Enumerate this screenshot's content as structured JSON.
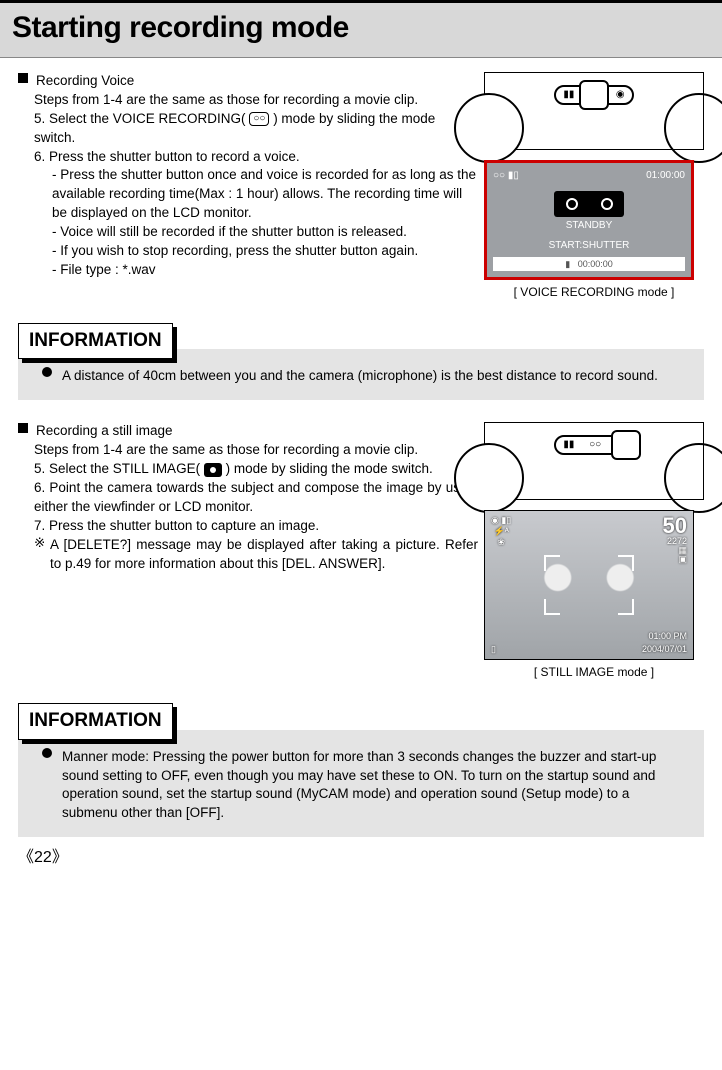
{
  "page": {
    "title": "Starting recording mode",
    "number": "22"
  },
  "voice": {
    "heading": "Recording Voice",
    "intro": "Steps from 1-4 are the same as those for recording a movie clip.",
    "step5_pre": "5. Select the VOICE RECORDING(",
    "step5_post": " ) mode by sliding the mode switch.",
    "step6": "6. Press the shutter button to record a voice.",
    "d1": "- Press the shutter button once and voice is recorded for as long as the available recording time(Max : 1 hour) allows. The recording time will be displayed on the LCD monitor.",
    "d2": "- Voice will still be recorded if the shutter button is released.",
    "d3": "- If you wish to stop recording, press the shutter button again.",
    "d4": "- File type : *.wav",
    "lcd": {
      "time": "01:00:00",
      "standby": "STANDBY",
      "start": "START:SHUTTER",
      "counter": "00:00:00"
    },
    "caption": "[ VOICE RECORDING mode ]"
  },
  "info1": {
    "heading": "INFORMATION",
    "text": "A distance of 40cm between you and the camera (microphone) is the best distance to record sound."
  },
  "still": {
    "heading": "Recording a still image",
    "intro": "Steps from 1-4 are the same as those for recording a movie clip.",
    "step5_pre": "5. Select the STILL IMAGE(",
    "step5_post": " ) mode by sliding the mode switch.",
    "step6": "6. Point the camera towards the subject and compose the image by using either the viewfinder or LCD monitor.",
    "step7": "7. Press the shutter button to capture an image.",
    "note_pre": "A [DELETE?] message may be displayed after taking a picture. Refer to p.49 for more information about this [DEL. ANSWER].",
    "lcd": {
      "shots": "50",
      "res": "2272",
      "time": "01:00 PM",
      "date": "2004/07/01"
    },
    "caption": "[ STILL IMAGE mode ]"
  },
  "info2": {
    "heading": "INFORMATION",
    "text": "Manner mode: Pressing the power button for more than 3 seconds changes the buzzer and start-up sound setting to OFF, even though you may have set these to ON. To turn on the startup sound and operation sound, set the startup sound (MyCAM mode) and operation sound (Setup mode) to a submenu other than [OFF]."
  },
  "icons": {
    "voice_rec": "○○",
    "video": "▮▮",
    "camera": "◉"
  }
}
